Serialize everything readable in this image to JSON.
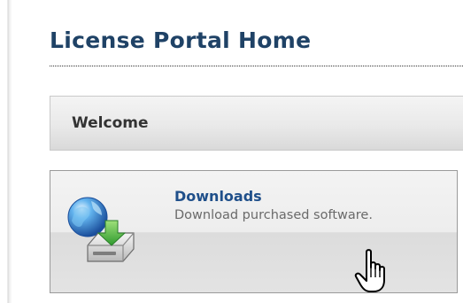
{
  "header": {
    "title": "License Portal Home"
  },
  "welcome": {
    "label": "Welcome"
  },
  "downloads_tile": {
    "title": "Downloads",
    "description": "Download purchased software.",
    "icon": "download-drive-icon"
  },
  "cursor": {
    "icon": "hand-pointer-icon"
  },
  "colors": {
    "title": "#1f4266",
    "link": "#1f4f8a",
    "muted_text": "#6a6a6a",
    "tile_border": "#9a9a9a"
  }
}
